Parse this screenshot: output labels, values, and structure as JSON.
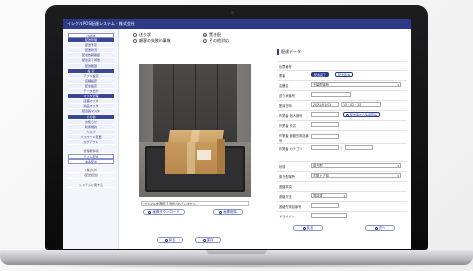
{
  "app": {
    "title": "イシクルPOS配達システム - 株式会社"
  },
  "sidebar": {
    "items": [
      {
        "label": "HOME",
        "style": "hl"
      },
      {
        "label": "配送管理",
        "style": "dark"
      },
      {
        "label": "配送予定",
        "style": ""
      },
      {
        "label": "配送状況",
        "style": ""
      },
      {
        "label": "配達依頼確認",
        "style": ""
      },
      {
        "label": "配達完了報告",
        "style": ""
      },
      {
        "label": "配送履歴",
        "style": ""
      },
      {
        "label": "設 定",
        "style": "dark"
      },
      {
        "label": "アプリ設定",
        "style": ""
      },
      {
        "label": "店舗設定",
        "style": ""
      },
      {
        "label": "配達設定",
        "style": ""
      },
      {
        "label": "データ出力",
        "style": ""
      },
      {
        "label": "マスタ管理",
        "style": "dark"
      },
      {
        "label": "店舗マスタ",
        "style": ""
      },
      {
        "label": "商品マスタ",
        "style": ""
      },
      {
        "label": "配達員マスタ",
        "style": ""
      },
      {
        "label": "その他",
        "style": "dark"
      },
      {
        "label": "お知らせ",
        "style": ""
      },
      {
        "label": "利用規約",
        "style": ""
      },
      {
        "label": "ヘルプ",
        "style": ""
      },
      {
        "label": "パスワード変更",
        "style": ""
      },
      {
        "label": "ログアウト",
        "style": ""
      },
      {
        "label": "管理者情報",
        "style": "plain gap"
      },
      {
        "label": "テスト配達",
        "style": "hl"
      },
      {
        "label": "本番配達",
        "style": "hl"
      },
      {
        "label": "(株)九州",
        "style": "plain gap"
      },
      {
        "label": "(配送担当)",
        "style": "plain"
      },
      {
        "label": "システムに関する",
        "style": "plain gap"
      }
    ]
  },
  "main": {
    "radios": [
      {
        "label": "送り状",
        "checked": false
      },
      {
        "label": "置き配",
        "checked": true
      },
      {
        "label": "顧客の失敗in事故",
        "checked": false
      },
      {
        "label": "その他対応",
        "checked": false
      }
    ],
    "file": {
      "button": "ファイルを選択",
      "status": "選択されていません"
    },
    "image_download": "画像ダウンロード",
    "image_delete": "画像削除",
    "back": "戻る",
    "save": "保存"
  },
  "panel": {
    "title": "配達データ",
    "rows": [
      {
        "label": "伝票番号",
        "value": ""
      },
      {
        "label": "業者",
        "value": ""
      },
      {
        "label": "店舗名",
        "value": "千葉配達所"
      },
      {
        "label": "送り状番号",
        "value": ""
      },
      {
        "label": "配達日時",
        "date": "2021/01/01",
        "time": "15 : 02 : 15"
      },
      {
        "label": "作業者 個人番号",
        "value": ""
      },
      {
        "label": "作業者 氏名",
        "value": ""
      },
      {
        "label": "作業者 連絡先電話番号",
        "value": ""
      },
      {
        "label": "作業者 カテゴリ",
        "value": "/"
      },
      {
        "label": "状態",
        "value": "置き配"
      },
      {
        "label": "置き配場所",
        "value": "玄関ドア前"
      },
      {
        "label": "連絡事項",
        "value": ""
      },
      {
        "label": "連絡方法",
        "value": "電話済"
      },
      {
        "label": "連絡先電話番号",
        "value": ""
      },
      {
        "label": "ドライバー",
        "value": ""
      }
    ],
    "buttons": {
      "done": "配達完了",
      "done_alt": "配達取消",
      "reg_driver": "配送員から情報取得",
      "back": "戻る",
      "next": "次へ"
    }
  }
}
